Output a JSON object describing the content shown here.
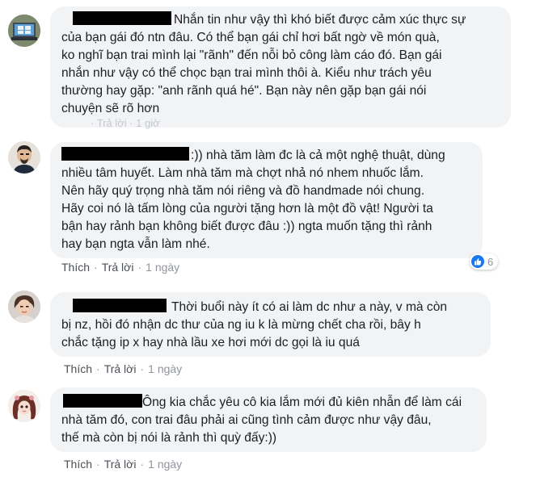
{
  "comments": [
    {
      "lines": [
        "Nhắn tin như vậy thì khó biết được cảm xúc thực sự",
        "của bạn gái đó ntn đâu. Có thể bạn gái chỉ hơi bất ngờ về món quà,",
        "ko nghĩ bạn trai mình lại \"rãnh\" đến nỗi bỏ công làm cáo đó. Bạn gái",
        "nhắn như vậy có thể chọc bạn trai mình thôi à. Kiểu như trách yêu",
        "thường hay gặp: \"anh rãnh quá hé\". Bạn này nên gặp bạn gái nói",
        "chuyện sẽ rõ hơn"
      ],
      "faded_meta": "· Trả lời · 1 giờ"
    },
    {
      "lines": [
        ":)) nhà tăm làm đc là cả một nghệ thuật, dùng",
        "nhiều tâm huyết. Làm nhà tăm mà chợt nhả nó nhem nhuốc lắm.",
        "Nên hãy quý trọng nhà tăm nói riêng và đồ handmade nói chung.",
        "Hãy coi nó là tấm lòng của người tặng hơn là một đồ vật! Người ta",
        "bận hay rảnh bạn không biết được đâu :)) ngta muốn tặng thì rảnh",
        "hay bạn ngta vẫn làm nhé."
      ],
      "actions": {
        "like": "Thích",
        "reply": "Trả lời",
        "time": "1 ngày"
      },
      "reaction_count": "6"
    },
    {
      "lines": [
        "Thời buổi này ít có ai làm dc như a này, v mà còn",
        "bị nz, hồi đó nhận dc thư của ng iu k là mừng chết cha rồi, bây h",
        "chắc tặng ip x hay nhà lầu xe hơi mới dc gọi là iu quá"
      ],
      "actions": {
        "like": "Thích",
        "reply": "Trả lời",
        "time": "1 ngày"
      }
    },
    {
      "lines": [
        "Ông kia chắc yêu cô kia lắm mới đủ kiên nhẫn để làm cái",
        "nhà tăm đó, con trai đâu phải ai cũng tình cảm được như vậy đâu,",
        "thế mà còn bị nói là rảnh thì quỳ đấy:))"
      ],
      "actions": {
        "like": "Thích",
        "reply": "Trả lời",
        "time": "1 ngày"
      }
    }
  ],
  "colors": {
    "bubble_bg": "#f2f3f5",
    "text": "#1c1e21",
    "meta": "#90949c",
    "link": "#4b4f56",
    "like_blue": "#1877f2"
  }
}
